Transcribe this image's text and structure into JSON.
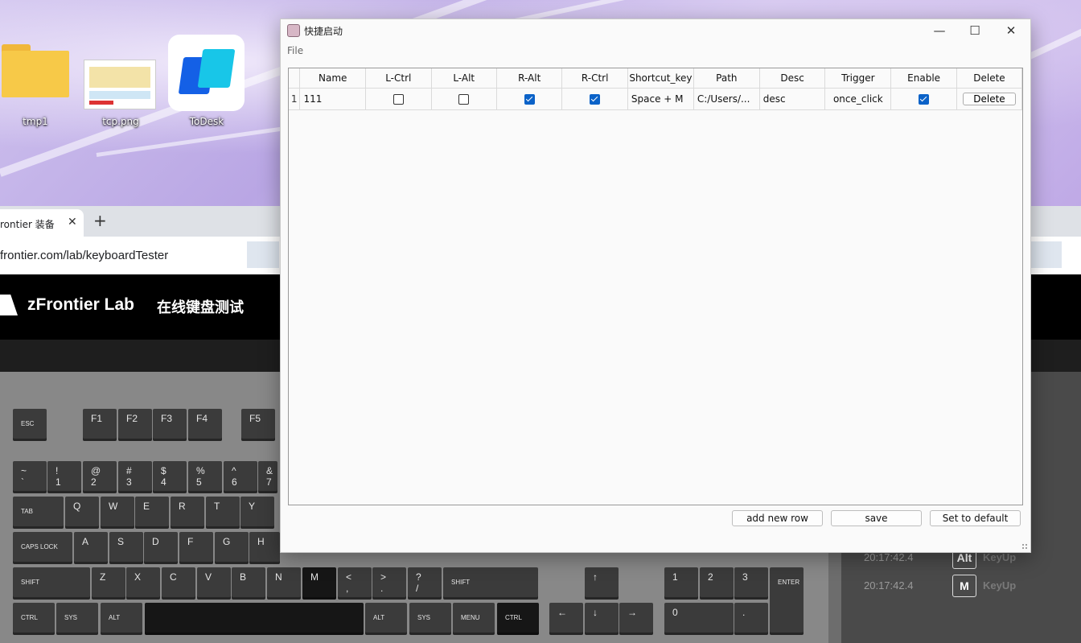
{
  "desktop": {
    "icons": [
      {
        "label": "tmp1",
        "icon": "folder-icon"
      },
      {
        "label": "tcp.png",
        "icon": "image-thumbnail-icon"
      },
      {
        "label": "ToDesk",
        "icon": "todesk-app-icon"
      }
    ]
  },
  "browser": {
    "tab_title": "rontier 装备",
    "tab_close": "✕",
    "new_tab": "+",
    "url": "frontier.com/lab/keyboardTester",
    "brand": "zFrontier Lab",
    "brand_sub": "在线键盘测试"
  },
  "keyboard": {
    "keys": [
      {
        "name": "key-esc",
        "small": "ESC"
      },
      {
        "name": "key-f1",
        "label": "F1"
      },
      {
        "name": "key-f2",
        "label": "F2"
      },
      {
        "name": "key-f3",
        "label": "F3"
      },
      {
        "name": "key-f4",
        "label": "F4"
      },
      {
        "name": "key-f5",
        "label": "F5"
      },
      {
        "name": "key-backtick",
        "top": "~",
        "bottom": "`"
      },
      {
        "name": "key-1",
        "top": "!",
        "bottom": "1"
      },
      {
        "name": "key-2",
        "top": "@",
        "bottom": "2"
      },
      {
        "name": "key-3",
        "top": "#",
        "bottom": "3"
      },
      {
        "name": "key-4",
        "top": "$",
        "bottom": "4"
      },
      {
        "name": "key-5",
        "top": "%",
        "bottom": "5"
      },
      {
        "name": "key-6",
        "top": "^",
        "bottom": "6"
      },
      {
        "name": "key-7",
        "top": "&",
        "bottom": "7"
      },
      {
        "name": "key-tab",
        "small": "TAB"
      },
      {
        "name": "key-q",
        "label": "Q"
      },
      {
        "name": "key-w",
        "label": "W"
      },
      {
        "name": "key-e",
        "label": "E"
      },
      {
        "name": "key-r",
        "label": "R"
      },
      {
        "name": "key-t",
        "label": "T"
      },
      {
        "name": "key-y",
        "label": "Y"
      },
      {
        "name": "key-capslock",
        "small": "CAPS LOCK"
      },
      {
        "name": "key-a",
        "label": "A"
      },
      {
        "name": "key-s",
        "label": "S"
      },
      {
        "name": "key-d",
        "label": "D"
      },
      {
        "name": "key-f",
        "label": "F"
      },
      {
        "name": "key-g",
        "label": "G"
      },
      {
        "name": "key-h",
        "label": "H"
      },
      {
        "name": "key-shift-left",
        "small": "SHIFT"
      },
      {
        "name": "key-z",
        "label": "Z"
      },
      {
        "name": "key-x",
        "label": "X"
      },
      {
        "name": "key-c",
        "label": "C"
      },
      {
        "name": "key-v",
        "label": "V"
      },
      {
        "name": "key-b",
        "label": "B"
      },
      {
        "name": "key-n",
        "label": "N"
      },
      {
        "name": "key-m",
        "label": "M"
      },
      {
        "name": "key-comma",
        "top": "<",
        "bottom": ","
      },
      {
        "name": "key-period",
        "top": ">",
        "bottom": "."
      },
      {
        "name": "key-slash",
        "top": "?",
        "bottom": "/"
      },
      {
        "name": "key-shift-right",
        "small": "SHIFT"
      },
      {
        "name": "key-ctrl-left",
        "small": "CTRL"
      },
      {
        "name": "key-sys-left",
        "small": "SYS"
      },
      {
        "name": "key-alt-left",
        "small": "ALT"
      },
      {
        "name": "key-space",
        "label": ""
      },
      {
        "name": "key-alt-right",
        "small": "ALT"
      },
      {
        "name": "key-sys-right",
        "small": "SYS"
      },
      {
        "name": "key-menu",
        "small": "MENU"
      },
      {
        "name": "key-ctrl-right",
        "small": "CTRL"
      },
      {
        "name": "key-arrow-up",
        "label": "↑"
      },
      {
        "name": "key-arrow-left",
        "label": "←"
      },
      {
        "name": "key-arrow-down",
        "label": "↓"
      },
      {
        "name": "key-arrow-right",
        "label": "→"
      },
      {
        "name": "key-num1",
        "label": "1"
      },
      {
        "name": "key-num2",
        "label": "2"
      },
      {
        "name": "key-num3",
        "label": "3"
      },
      {
        "name": "key-num0",
        "label": "0"
      },
      {
        "name": "key-numdot",
        "label": "."
      },
      {
        "name": "key-enter",
        "small": "ENTER"
      }
    ]
  },
  "log": [
    {
      "time": "20:17:42.4",
      "key": "Alt",
      "kind": "KeyUp"
    },
    {
      "time": "20:17:42.4",
      "key": "M",
      "kind": "KeyUp"
    }
  ],
  "window": {
    "title": "快捷启动",
    "menu_file": "File",
    "columns": [
      "Name",
      "L-Ctrl",
      "L-Alt",
      "R-Alt",
      "R-Ctrl",
      "Shortcut_key",
      "Path",
      "Desc",
      "Trigger",
      "Enable",
      "Delete"
    ],
    "rows": [
      {
        "row_number": "1",
        "name": "111",
        "l_ctrl": false,
        "l_alt": false,
        "r_alt": true,
        "r_ctrl": true,
        "shortcut_key": "Space + M",
        "path": "C:/Users/...",
        "desc": "desc",
        "trigger": "once_click",
        "enable": true,
        "delete_label": "Delete"
      }
    ],
    "buttons": {
      "add_row": "add new row",
      "save": "save",
      "default": "Set to default"
    },
    "controls": {
      "minimize": "—",
      "maximize": "☐",
      "close": "✕"
    }
  }
}
